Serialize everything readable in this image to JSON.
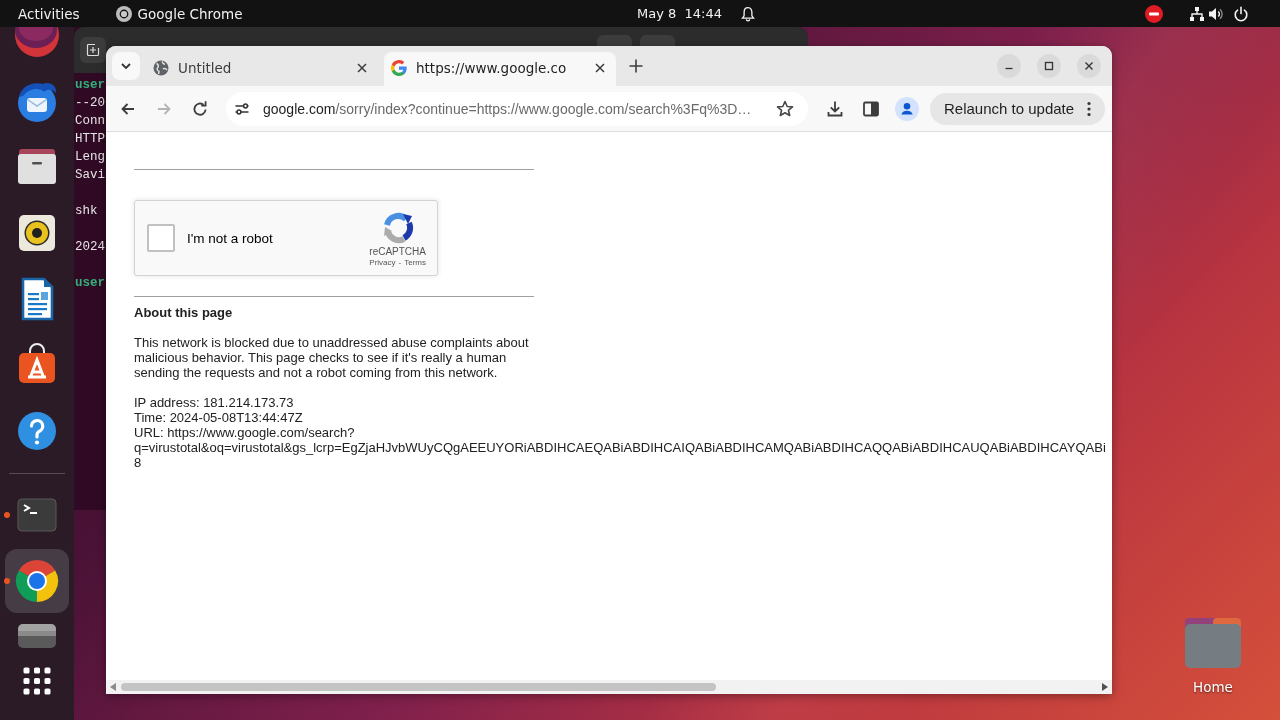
{
  "top_bar": {
    "activities": "Activities",
    "app_name": "Google Chrome",
    "clock": "May 8  14:44"
  },
  "dock": {
    "groups": [
      {
        "items": [
          {
            "kind": "orb",
            "running": false,
            "selected": false
          },
          {
            "kind": "mail",
            "running": false,
            "selected": false
          },
          {
            "kind": "folder",
            "running": false,
            "selected": false
          },
          {
            "kind": "speaker",
            "running": false,
            "selected": false
          },
          {
            "kind": "document",
            "running": false,
            "selected": false
          },
          {
            "kind": "store",
            "running": false,
            "selected": false
          },
          {
            "kind": "help",
            "running": false,
            "selected": false
          }
        ]
      },
      {
        "items": [
          {
            "kind": "terminal",
            "running": true,
            "selected": false
          },
          {
            "kind": "browser",
            "running": true,
            "selected": true
          },
          {
            "kind": "drive",
            "running": false,
            "selected": false
          },
          {
            "kind": "grid",
            "running": false,
            "selected": false
          }
        ]
      }
    ]
  },
  "terminal": {
    "blocks": [
      {
        "lines": [
          {
            "text": "user",
            "kind": "prompt"
          },
          {
            "text": "--20",
            "kind": "output"
          },
          {
            "text": "Conn",
            "kind": "output"
          },
          {
            "text": "HTTP",
            "kind": "output"
          },
          {
            "text": "Leng",
            "kind": "output"
          },
          {
            "text": "Savi",
            "kind": "output"
          }
        ]
      },
      {
        "lines": [
          {
            "text": "shk",
            "kind": "output"
          }
        ]
      },
      {
        "lines": [
          {
            "text": "2024",
            "kind": "output"
          }
        ]
      },
      {
        "lines": [
          {
            "text": "user",
            "kind": "prompt"
          }
        ]
      }
    ]
  },
  "browser": {
    "tabs": [
      {
        "title": "Untitled",
        "kind": "default",
        "selected": false
      },
      {
        "title": "https://www.google.co",
        "kind": "site",
        "selected": true
      }
    ],
    "nav": [
      {
        "kind": "back",
        "disabled": false
      },
      {
        "kind": "forward",
        "disabled": true
      },
      {
        "kind": "reload",
        "disabled": false
      }
    ],
    "address": {
      "host": "google.com",
      "path": "/sorry/index?continue=https://www.google.com/search%3Fq%3D…"
    },
    "relaunch": "Relaunch to update",
    "page": {
      "captcha": {
        "label": "I'm not a robot",
        "checked": false,
        "brand": "reCAPTCHA",
        "privacy": "Privacy",
        "separator": "-",
        "terms": "Terms"
      },
      "heading": "About this page",
      "paragraph": "This network is blocked due to unaddressed abuse complaints about malicious behavior. This page checks to see if it's really a human sending the requests and not a robot coming from this network.",
      "details": [
        "IP address: 181.214.173.73",
        "Time: 2024-05-08T13:44:47Z",
        "URL: https://www.google.com/search?",
        "q=virustotal&oq=virustotal&gs_lcrp=EgZjaHJvbWUyCQgAEEUYORiABDIHCAEQABiABDIHCAIQABiABDIHCAMQABiABDIHCAQQABiABDIHCAUQABiABDIHCAYQABi",
        "8"
      ]
    }
  },
  "desktop": {
    "home_label": "Home"
  }
}
